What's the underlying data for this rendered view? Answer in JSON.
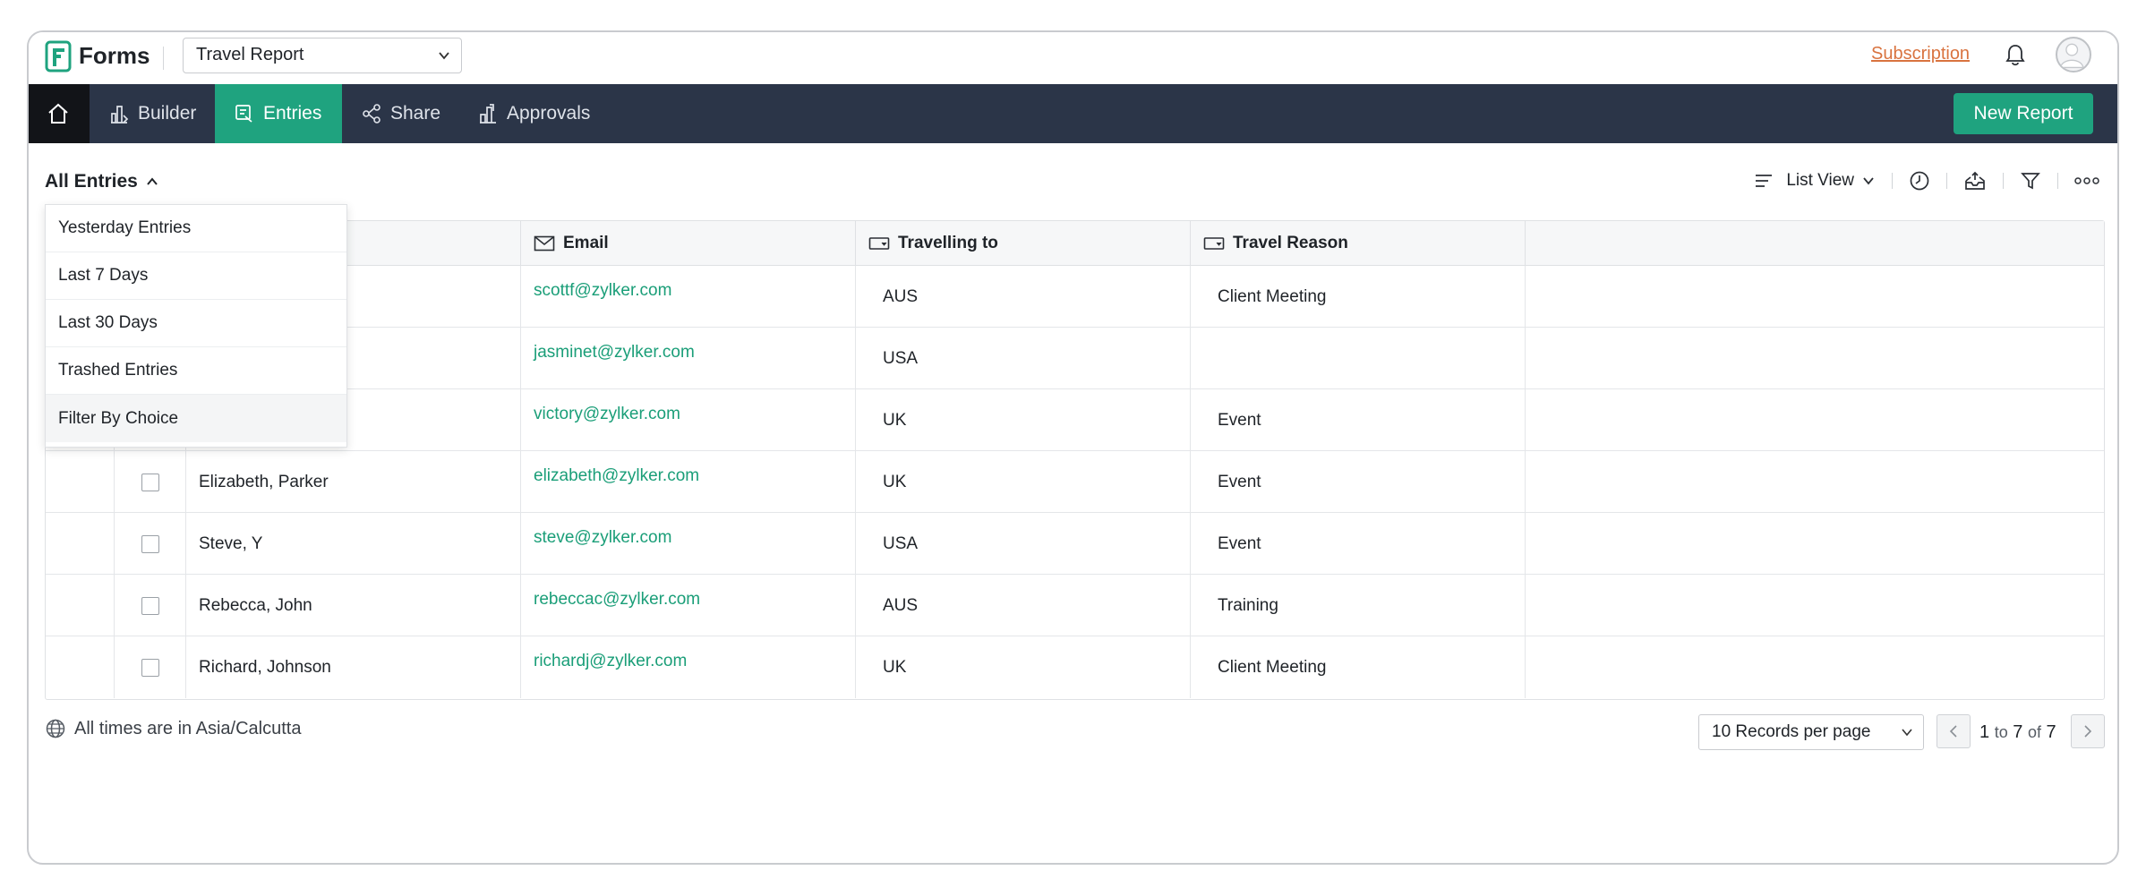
{
  "app": {
    "brand": "Forms",
    "form_name": "Travel Report",
    "subscription_label": "Subscription"
  },
  "nav": {
    "items": [
      {
        "label": "Builder",
        "icon": "builder-icon"
      },
      {
        "label": "Entries",
        "icon": "entries-icon",
        "active": true
      },
      {
        "label": "Share",
        "icon": "share-icon"
      },
      {
        "label": "Approvals",
        "icon": "approvals-icon"
      }
    ],
    "new_report_label": "New Report"
  },
  "toolbar": {
    "view_selector": "All Entries",
    "list_view_label": "List View"
  },
  "dropdown": {
    "items": [
      "Yesterday Entries",
      "Last 7 Days",
      "Last 30 Days",
      "Trashed Entries",
      "Filter By Choice"
    ]
  },
  "table": {
    "columns": [
      {
        "label": "Email",
        "icon": "mail-icon"
      },
      {
        "label": "Travelling to",
        "icon": "dropdown-field-icon"
      },
      {
        "label": "Travel Reason",
        "icon": "dropdown-field-icon"
      }
    ],
    "rows": [
      {
        "name": "",
        "email": "scottf@zylker.com",
        "travelling_to": "AUS",
        "reason": "Client Meeting"
      },
      {
        "name": "",
        "email": "jasminet@zylker.com",
        "travelling_to": "USA",
        "reason": ""
      },
      {
        "name": "",
        "email": "victory@zylker.com",
        "travelling_to": "UK",
        "reason": "Event"
      },
      {
        "name": "Elizabeth, Parker",
        "email": "elizabeth@zylker.com",
        "travelling_to": "UK",
        "reason": "Event"
      },
      {
        "name": "Steve, Y",
        "email": "steve@zylker.com",
        "travelling_to": "USA",
        "reason": "Event"
      },
      {
        "name": "Rebecca, John",
        "email": "rebeccac@zylker.com",
        "travelling_to": "AUS",
        "reason": "Training"
      },
      {
        "name": "Richard, Johnson",
        "email": "richardj@zylker.com",
        "travelling_to": "UK",
        "reason": "Client Meeting"
      }
    ]
  },
  "footer": {
    "timezone_text": "All times are in Asia/Calcutta",
    "per_page": "10 Records per page",
    "page_from": "1",
    "page_to_word": "to",
    "page_to": "7",
    "page_of_word": "of",
    "page_total": "7"
  },
  "colors": {
    "accent": "#1fa37f",
    "nav_bg": "#2b3548",
    "link": "#1a9e78",
    "subscription": "#d9733f"
  }
}
